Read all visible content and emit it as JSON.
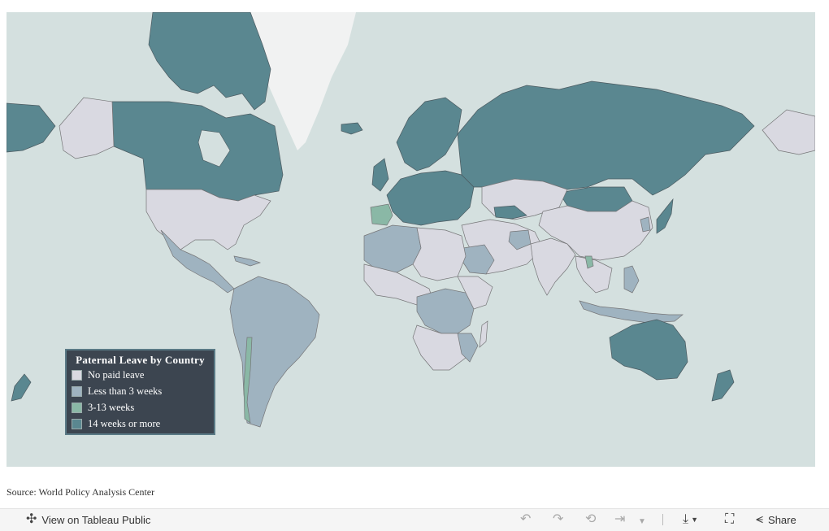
{
  "legend": {
    "title": "Paternal Leave by Country",
    "items": [
      {
        "label": "No paid leave",
        "color": "#d9d9e1"
      },
      {
        "label": "Less than 3 weeks",
        "color": "#9fb3c0"
      },
      {
        "label": "3-13 weeks",
        "color": "#8ab8a6"
      },
      {
        "label": "14 weeks or more",
        "color": "#5a8790"
      }
    ]
  },
  "source": "Source: World Policy Analysis Center",
  "colors": {
    "ocean": "#d4e0df",
    "legend_bg": "#3c4550"
  },
  "toolbar": {
    "view_label": "View on Tableau Public",
    "share_label": "Share",
    "icons": [
      "tableau-icon",
      "undo-icon",
      "redo-icon",
      "revert-icon",
      "refresh-icon",
      "pause-dropdown-icon",
      "download-icon",
      "fullscreen-icon",
      "share-icon"
    ]
  }
}
